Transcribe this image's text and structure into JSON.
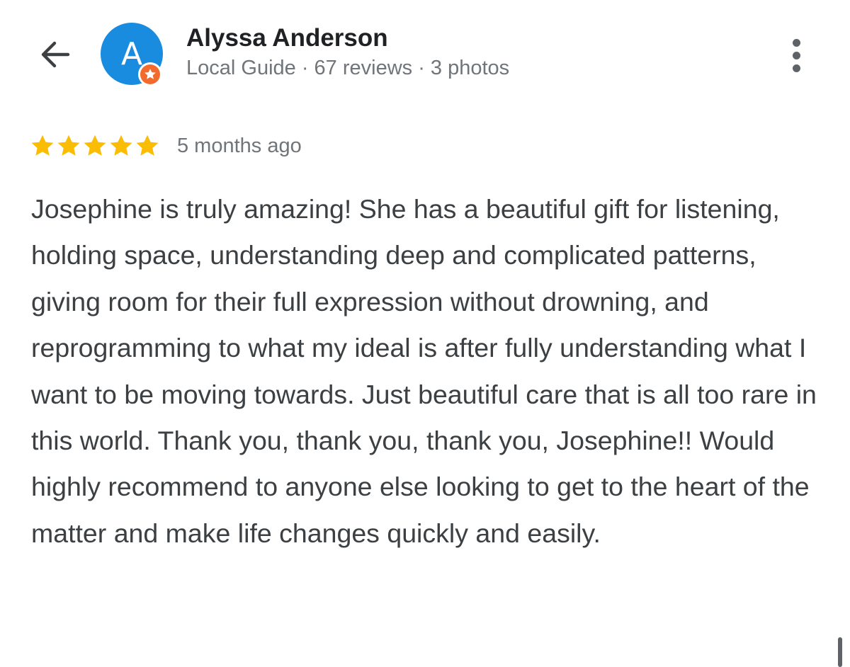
{
  "reviewer": {
    "name": "Alyssa Anderson",
    "avatar_letter": "A",
    "avatar_color": "#1a8ce0",
    "badge_color": "#f26b2c",
    "meta": "Local Guide · 67 reviews · 3 photos"
  },
  "review": {
    "rating": 5,
    "max_rating": 5,
    "star_color": "#fbbc04",
    "time_ago": "5 months ago",
    "text": "Josephine is truly amazing! She has a beautiful gift for listening, holding space, understanding deep and complicated patterns, giving room for their full expression without drowning, and reprogramming to what my ideal is after fully understanding what I want to be moving towards. Just beautiful care that is all too rare in this world. Thank you, thank you, thank you, Josephine!! Would highly recommend to anyone else looking to get to the heart of the matter and make life changes quickly and easily."
  },
  "icons": {
    "back": "arrow-back-icon",
    "more": "more-vert-icon",
    "badge": "local-guide-star-icon",
    "star": "star-icon"
  }
}
